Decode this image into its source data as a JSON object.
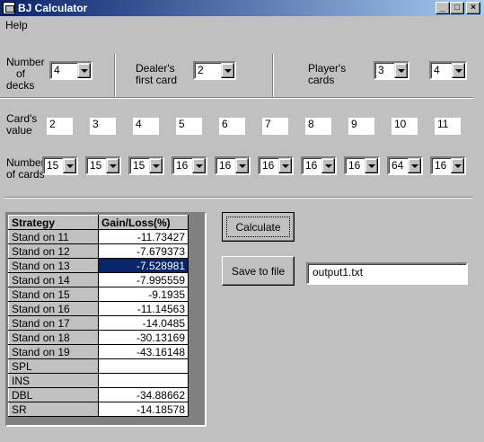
{
  "window": {
    "title": "BJ Calculator",
    "controls": {
      "minimize": "_",
      "maximize": "□",
      "close": "×"
    }
  },
  "menu": {
    "help": "Help"
  },
  "settings": {
    "decks_label_line1": "Number",
    "decks_label_line2": "of",
    "decks_label_line3": "decks",
    "decks_value": "4",
    "dealer_label_line1": "Dealer's",
    "dealer_label_line2": "first card",
    "dealer_value": "2",
    "player_label_line1": "Player's",
    "player_label_line2": "cards",
    "player_card1_value": "3",
    "player_card2_value": "4"
  },
  "cards": {
    "value_label_line1": "Card's",
    "value_label_line2": "value",
    "count_label_line1": "Number",
    "count_label_line2": "of cards",
    "values": [
      "2",
      "3",
      "4",
      "5",
      "6",
      "7",
      "8",
      "9",
      "10",
      "11"
    ],
    "counts": [
      "15",
      "15",
      "15",
      "16",
      "16",
      "16",
      "16",
      "16",
      "64",
      "16"
    ]
  },
  "grid": {
    "col_strategy": "Strategy",
    "col_gain": "Gain/Loss(%)",
    "selected_row": 2,
    "rows": [
      {
        "strategy": "Stand  on 11",
        "gain": "-11.73427"
      },
      {
        "strategy": "Stand  on 12",
        "gain": "-7.679373"
      },
      {
        "strategy": "Stand  on 13",
        "gain": "-7.528981"
      },
      {
        "strategy": "Stand  on 14",
        "gain": "-7.995559"
      },
      {
        "strategy": "Stand  on 15",
        "gain": "-9.1935"
      },
      {
        "strategy": "Stand  on 16",
        "gain": "-11.14563"
      },
      {
        "strategy": "Stand  on 17",
        "gain": "-14.0485"
      },
      {
        "strategy": "Stand  on 18",
        "gain": "-30.13169"
      },
      {
        "strategy": "Stand  on 19",
        "gain": "-43.16148"
      },
      {
        "strategy": "SPL",
        "gain": ""
      },
      {
        "strategy": "INS",
        "gain": ""
      },
      {
        "strategy": "DBL",
        "gain": "-34.88662"
      },
      {
        "strategy": "SR",
        "gain": "-14.18578"
      }
    ]
  },
  "actions": {
    "calculate_label": "Calculate",
    "save_label": "Save to file",
    "output_filename": "output1.txt"
  },
  "colors": {
    "titlebar_start": "#0a246a",
    "titlebar_end": "#a6caf0",
    "face": "#c0c0c0",
    "selection": "#0a246a"
  }
}
